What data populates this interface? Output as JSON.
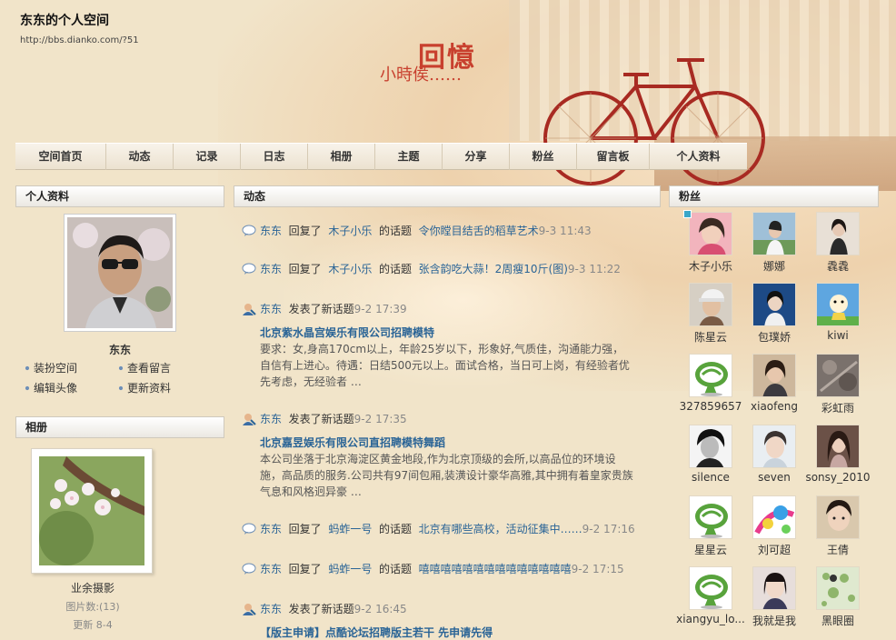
{
  "site": {
    "title": "东东的个人空间",
    "url": "http://bbs.dianko.com/?51",
    "banner_big": "回憶",
    "banner_small": "小時侯……"
  },
  "nav": [
    "空间首页",
    "动态",
    "记录",
    "日志",
    "相册",
    "主题",
    "分享",
    "粉丝",
    "留言板",
    "个人资料"
  ],
  "profile": {
    "header": "个人资料",
    "name": "东东",
    "links": [
      "装扮空间",
      "查看留言",
      "编辑头像",
      "更新资料"
    ]
  },
  "album": {
    "header": "相册",
    "name": "业余摄影",
    "count": "图片数:(13)",
    "updated": "更新 8-4"
  },
  "feed": {
    "header": "动态",
    "items": [
      {
        "actor": "东东",
        "verb": "回复了",
        "target": "木子小乐",
        "mid": "的话题",
        "topic": "令你瞠目结舌的稻草艺术",
        "time": "9-3 11:43"
      },
      {
        "actor": "东东",
        "verb": "回复了",
        "target": "木子小乐",
        "mid": "的话题",
        "topic": "张含韵吃大蒜！2周瘦10斤(图)",
        "time": "9-3 11:22"
      },
      {
        "actor": "东东",
        "verb": "发表了新话题",
        "time": "9-2 17:39",
        "title": "北京紫水晶宫娱乐有限公司招聘模特",
        "body": "要求：女,身高170cm以上，年龄25岁以下，形象好,气质佳，沟通能力强，自信有上进心。待遇：日结500元以上。面试合格，当日可上岗，有经验者优先考虑，无经验者 …"
      },
      {
        "actor": "东东",
        "verb": "发表了新话题",
        "time": "9-2 17:35",
        "title": "北京嘉昱娱乐有限公司直招聘模特舞蹈",
        "body": "本公司坐落于北京海淀区黄金地段,作为北京顶级的会所,以高品位的环境设施，高品质的服务.公司共有97间包厢,装潢设计豪华高雅,其中拥有着皇家贵族气息和风格迥异豪 …"
      },
      {
        "actor": "东东",
        "verb": "回复了",
        "target": "蚂蚱一号",
        "mid": "的话题",
        "topic": "北京有哪些高校，活动征集中……",
        "time": "9-2 17:16"
      },
      {
        "actor": "东东",
        "verb": "回复了",
        "target": "蚂蚱一号",
        "mid": "的话题",
        "topic": "嘻嘻嘻嘻嘻嘻嘻嘻嘻嘻嘻嘻嘻嘻",
        "time": "9-2 17:15"
      },
      {
        "actor": "东东",
        "verb": "发表了新话题",
        "time": "9-2 16:45",
        "title": "【版主申请】点酷论坛招聘版主若干 先申请先得"
      }
    ]
  },
  "fans": {
    "header": "粉丝",
    "list": [
      {
        "name": "木子小乐",
        "avatar": "girl-pink"
      },
      {
        "name": "娜娜",
        "avatar": "girl-outdoor"
      },
      {
        "name": "毳毳",
        "avatar": "girl-dark"
      },
      {
        "name": "陈星云",
        "avatar": "boy-cap"
      },
      {
        "name": "包璞娇",
        "avatar": "girl-blue"
      },
      {
        "name": "kiwi",
        "avatar": "cartoon"
      },
      {
        "name": "327859657",
        "avatar": "default-qq"
      },
      {
        "name": "xiaofeng",
        "avatar": "girl-brown"
      },
      {
        "name": "彩虹雨",
        "avatar": "texture"
      },
      {
        "name": "silence",
        "avatar": "boy-bw"
      },
      {
        "name": "seven",
        "avatar": "boy-light"
      },
      {
        "name": "sonsy_2010",
        "avatar": "girl-long"
      },
      {
        "name": "星星云",
        "avatar": "default-qq"
      },
      {
        "name": "刘可超",
        "avatar": "art-colorful"
      },
      {
        "name": "王倩",
        "avatar": "girl-face"
      },
      {
        "name": "xiangyu_lo...",
        "avatar": "default-qq"
      },
      {
        "name": "我就是我",
        "avatar": "girl-bangs"
      },
      {
        "name": "黑眼圈",
        "avatar": "green-pattern"
      }
    ]
  },
  "colors": {
    "link": "#2a6496",
    "background": "#f1e4c9",
    "banner_red": "#c8402e"
  }
}
